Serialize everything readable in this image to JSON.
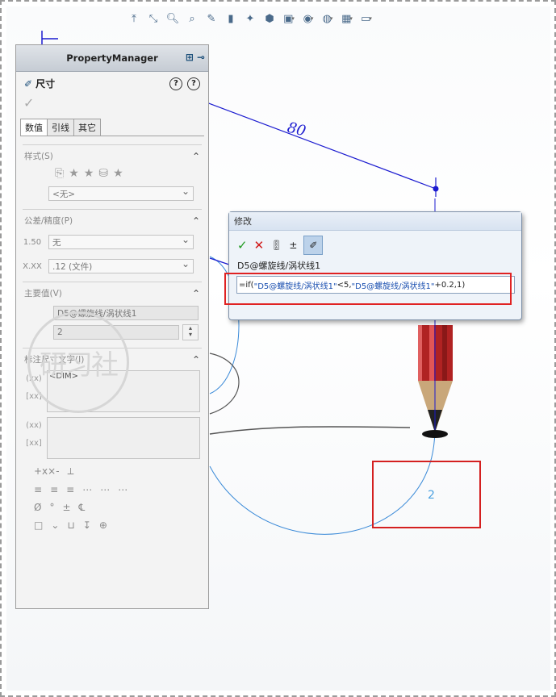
{
  "toolbar": {
    "icons": [
      "view-orient-icon",
      "zoom-fit-icon",
      "zoom-area-icon",
      "zoom-icon",
      "section-icon",
      "prev-view-icon",
      "feature-icon",
      "cube-icon",
      "display-style-icon",
      "hide-show-icon",
      "appearance-icon",
      "scene-icon",
      "monitor-icon"
    ]
  },
  "graphics": {
    "dimension_80": "80",
    "dimension_2": "2"
  },
  "property_manager": {
    "header": "PropertyManager",
    "title": "尺寸",
    "help1": "?",
    "help2": "?",
    "tabs": [
      "数值",
      "引线",
      "其它"
    ],
    "style": {
      "heading": "样式(S)",
      "select_value": "<无>"
    },
    "tolerance": {
      "heading": "公差/精度(P)",
      "tolerance_value": "无",
      "precision_value": ".12 (文件)",
      "icon1_text": "1.50",
      "icon2_text": "X.XX"
    },
    "primary": {
      "heading": "主要值(V)",
      "name_value": "D5@螺旋线/涡状线1",
      "number_value": "2"
    },
    "dim_text": {
      "heading": "标注尺寸文字(I)",
      "text1": "<DIM>",
      "text2": ""
    },
    "symbols": {
      "row1": [
        "+x×-",
        "⟂"
      ],
      "row2": [
        "≡",
        "≡",
        "≡",
        "⋯",
        "⋯",
        "⋯"
      ],
      "row3": [
        "Ø",
        "°",
        "±",
        "℄"
      ],
      "row4": [
        "□",
        "⌄",
        "⊔",
        "↧",
        "⊕"
      ]
    },
    "watermark": "研习社"
  },
  "modify_dialog": {
    "title": "修改",
    "dim_name": "D5@螺旋线/涡状线1",
    "expression_prefix": "=if( ",
    "expression_ref1": "\"D5@螺旋线/涡状线1\"",
    "expression_mid": "<5,",
    "expression_ref2": "\"D5@螺旋线/涡状线1\"",
    "expression_suffix": "+0.2,1)",
    "colors": {
      "accent": "#1a4fb0",
      "highlight": "#e02222"
    }
  }
}
